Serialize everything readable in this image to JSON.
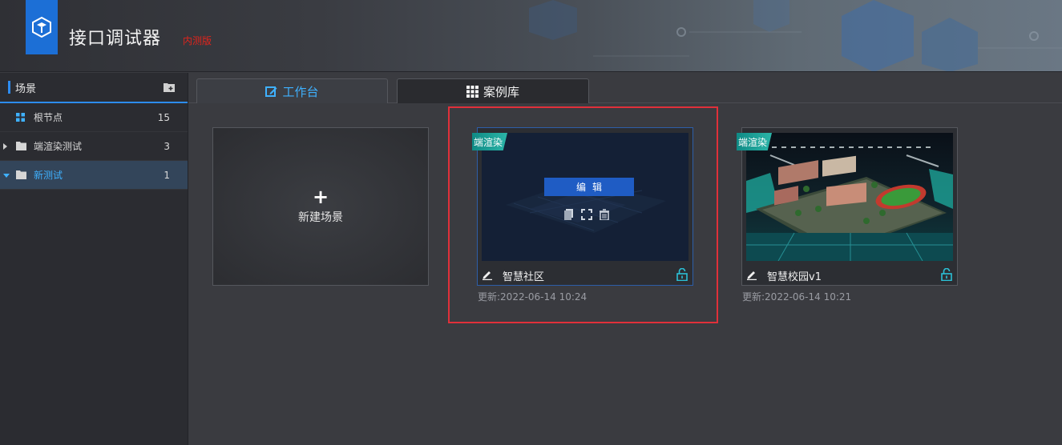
{
  "header": {
    "app_title": "接口调试器",
    "badge": "内测版",
    "logo_icon": "cube-logo-icon"
  },
  "sidebar": {
    "title": "场景",
    "add_icon": "new-folder-icon",
    "items": [
      {
        "label": "根节点",
        "count": "15",
        "icon": "grid-icon"
      },
      {
        "label": "端渲染测试",
        "count": "3",
        "icon": "folder-icon"
      },
      {
        "label": "新测试",
        "count": "1",
        "icon": "folder-icon",
        "active": true
      }
    ]
  },
  "tabs": [
    {
      "label": "工作台",
      "icon": "edit-square-icon",
      "active": true
    },
    {
      "label": "案例库",
      "icon": "grid-icon",
      "active": false
    }
  ],
  "new_card": {
    "plus": "+",
    "label": "新建场景"
  },
  "cards": [
    {
      "ribbon": "端渲染",
      "name": "智慧社区",
      "updated": "更新:2022-06-14 10:24",
      "edit_label": "编辑"
    },
    {
      "ribbon": "端渲染",
      "name": "智慧校园v1",
      "updated": "更新:2022-06-14 10:21"
    }
  ],
  "colors": {
    "accent": "#2d8cf0",
    "active_text": "#3fb1ff",
    "badge": "#e0241c",
    "highlight": "#e0303a",
    "ribbon": "#1fa39a"
  }
}
